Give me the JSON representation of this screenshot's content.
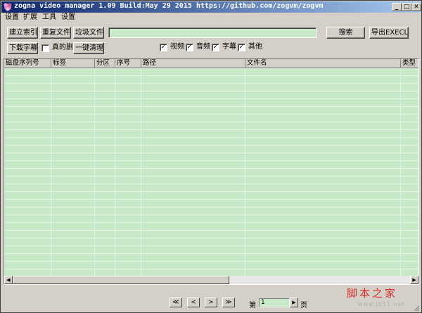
{
  "window": {
    "title": "zogna video manager 1.09 Build:May 29 2015  https://github.com/zogvm/zogvm",
    "minimize": "_",
    "maximize": "□",
    "close": "✕"
  },
  "menu": [
    "设置",
    "扩展",
    "工具",
    "设置"
  ],
  "toolbar": {
    "build_index": "建立索引",
    "duplicate_files": "重复文件",
    "junk_files": "垃圾文件",
    "search_value": "",
    "search": "搜索",
    "export_excel": "导出EXECL",
    "download_subtitles": "下载字幕",
    "real_delete": "真的删",
    "one_click_clean": "一键清理"
  },
  "filters": [
    {
      "label": "视频",
      "checked": true
    },
    {
      "label": "音频",
      "checked": true
    },
    {
      "label": "字幕",
      "checked": true
    },
    {
      "label": "其他",
      "checked": true
    }
  ],
  "table": {
    "columns": [
      "磁盘序列号",
      "标签",
      "分区",
      "序号",
      "路径",
      "文件名",
      "类型"
    ]
  },
  "pagination": {
    "first": "≪",
    "prev": "<",
    "next": ">",
    "last": "≫",
    "page_prefix": "第",
    "page_value": "1",
    "page_suffix": "页"
  },
  "watermark": {
    "main": "脚本之家",
    "sub": "www.jb51.net"
  },
  "colors": {
    "table_bg": "#c8eac8",
    "title_start": "#0a246a",
    "watermark": "#d43030"
  }
}
